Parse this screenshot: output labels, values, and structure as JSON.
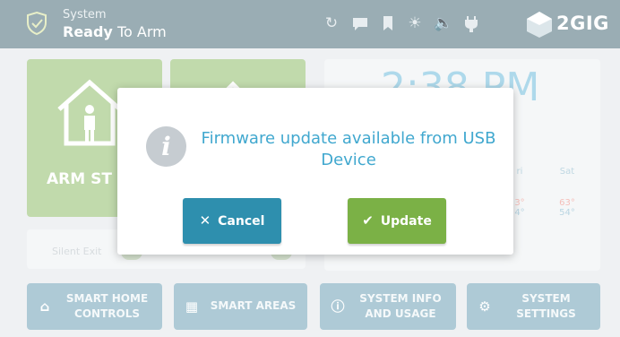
{
  "status_bar": {
    "system_label": "System",
    "status_bold": "Ready",
    "status_rest": " To Arm",
    "brand": "2GIG",
    "icons": [
      "refresh-icon",
      "message-icon",
      "bookmark-icon",
      "brightness-icon",
      "volume-icon",
      "plug-icon"
    ]
  },
  "main": {
    "arm_label": "ARM ST",
    "clock_time": "2:38 PM",
    "weather": [
      {
        "day": "ri",
        "high": "3°",
        "low": "4°"
      },
      {
        "day": "Sat",
        "high": "63°",
        "low": "54°"
      }
    ],
    "silent_exit": "Silent Exit"
  },
  "dialog": {
    "message": "Firmware update available from USB Device",
    "cancel_label": "Cancel",
    "update_label": "Update"
  },
  "nav": [
    {
      "line1": "SMART HOME",
      "line2": "CONTROLS"
    },
    {
      "line1": "SMART AREAS",
      "line2": ""
    },
    {
      "line1": "SYSTEM INFO",
      "line2": "AND USAGE"
    },
    {
      "line1": "SYSTEM",
      "line2": "SETTINGS"
    }
  ],
  "colors": {
    "topbar": "#7f9ea8",
    "arm_tile": "#a9cc8c",
    "dialog_text": "#41a8cf",
    "cancel_button": "#2e8fae",
    "update_button": "#7bb146",
    "nav_button": "#8fb6c7"
  }
}
